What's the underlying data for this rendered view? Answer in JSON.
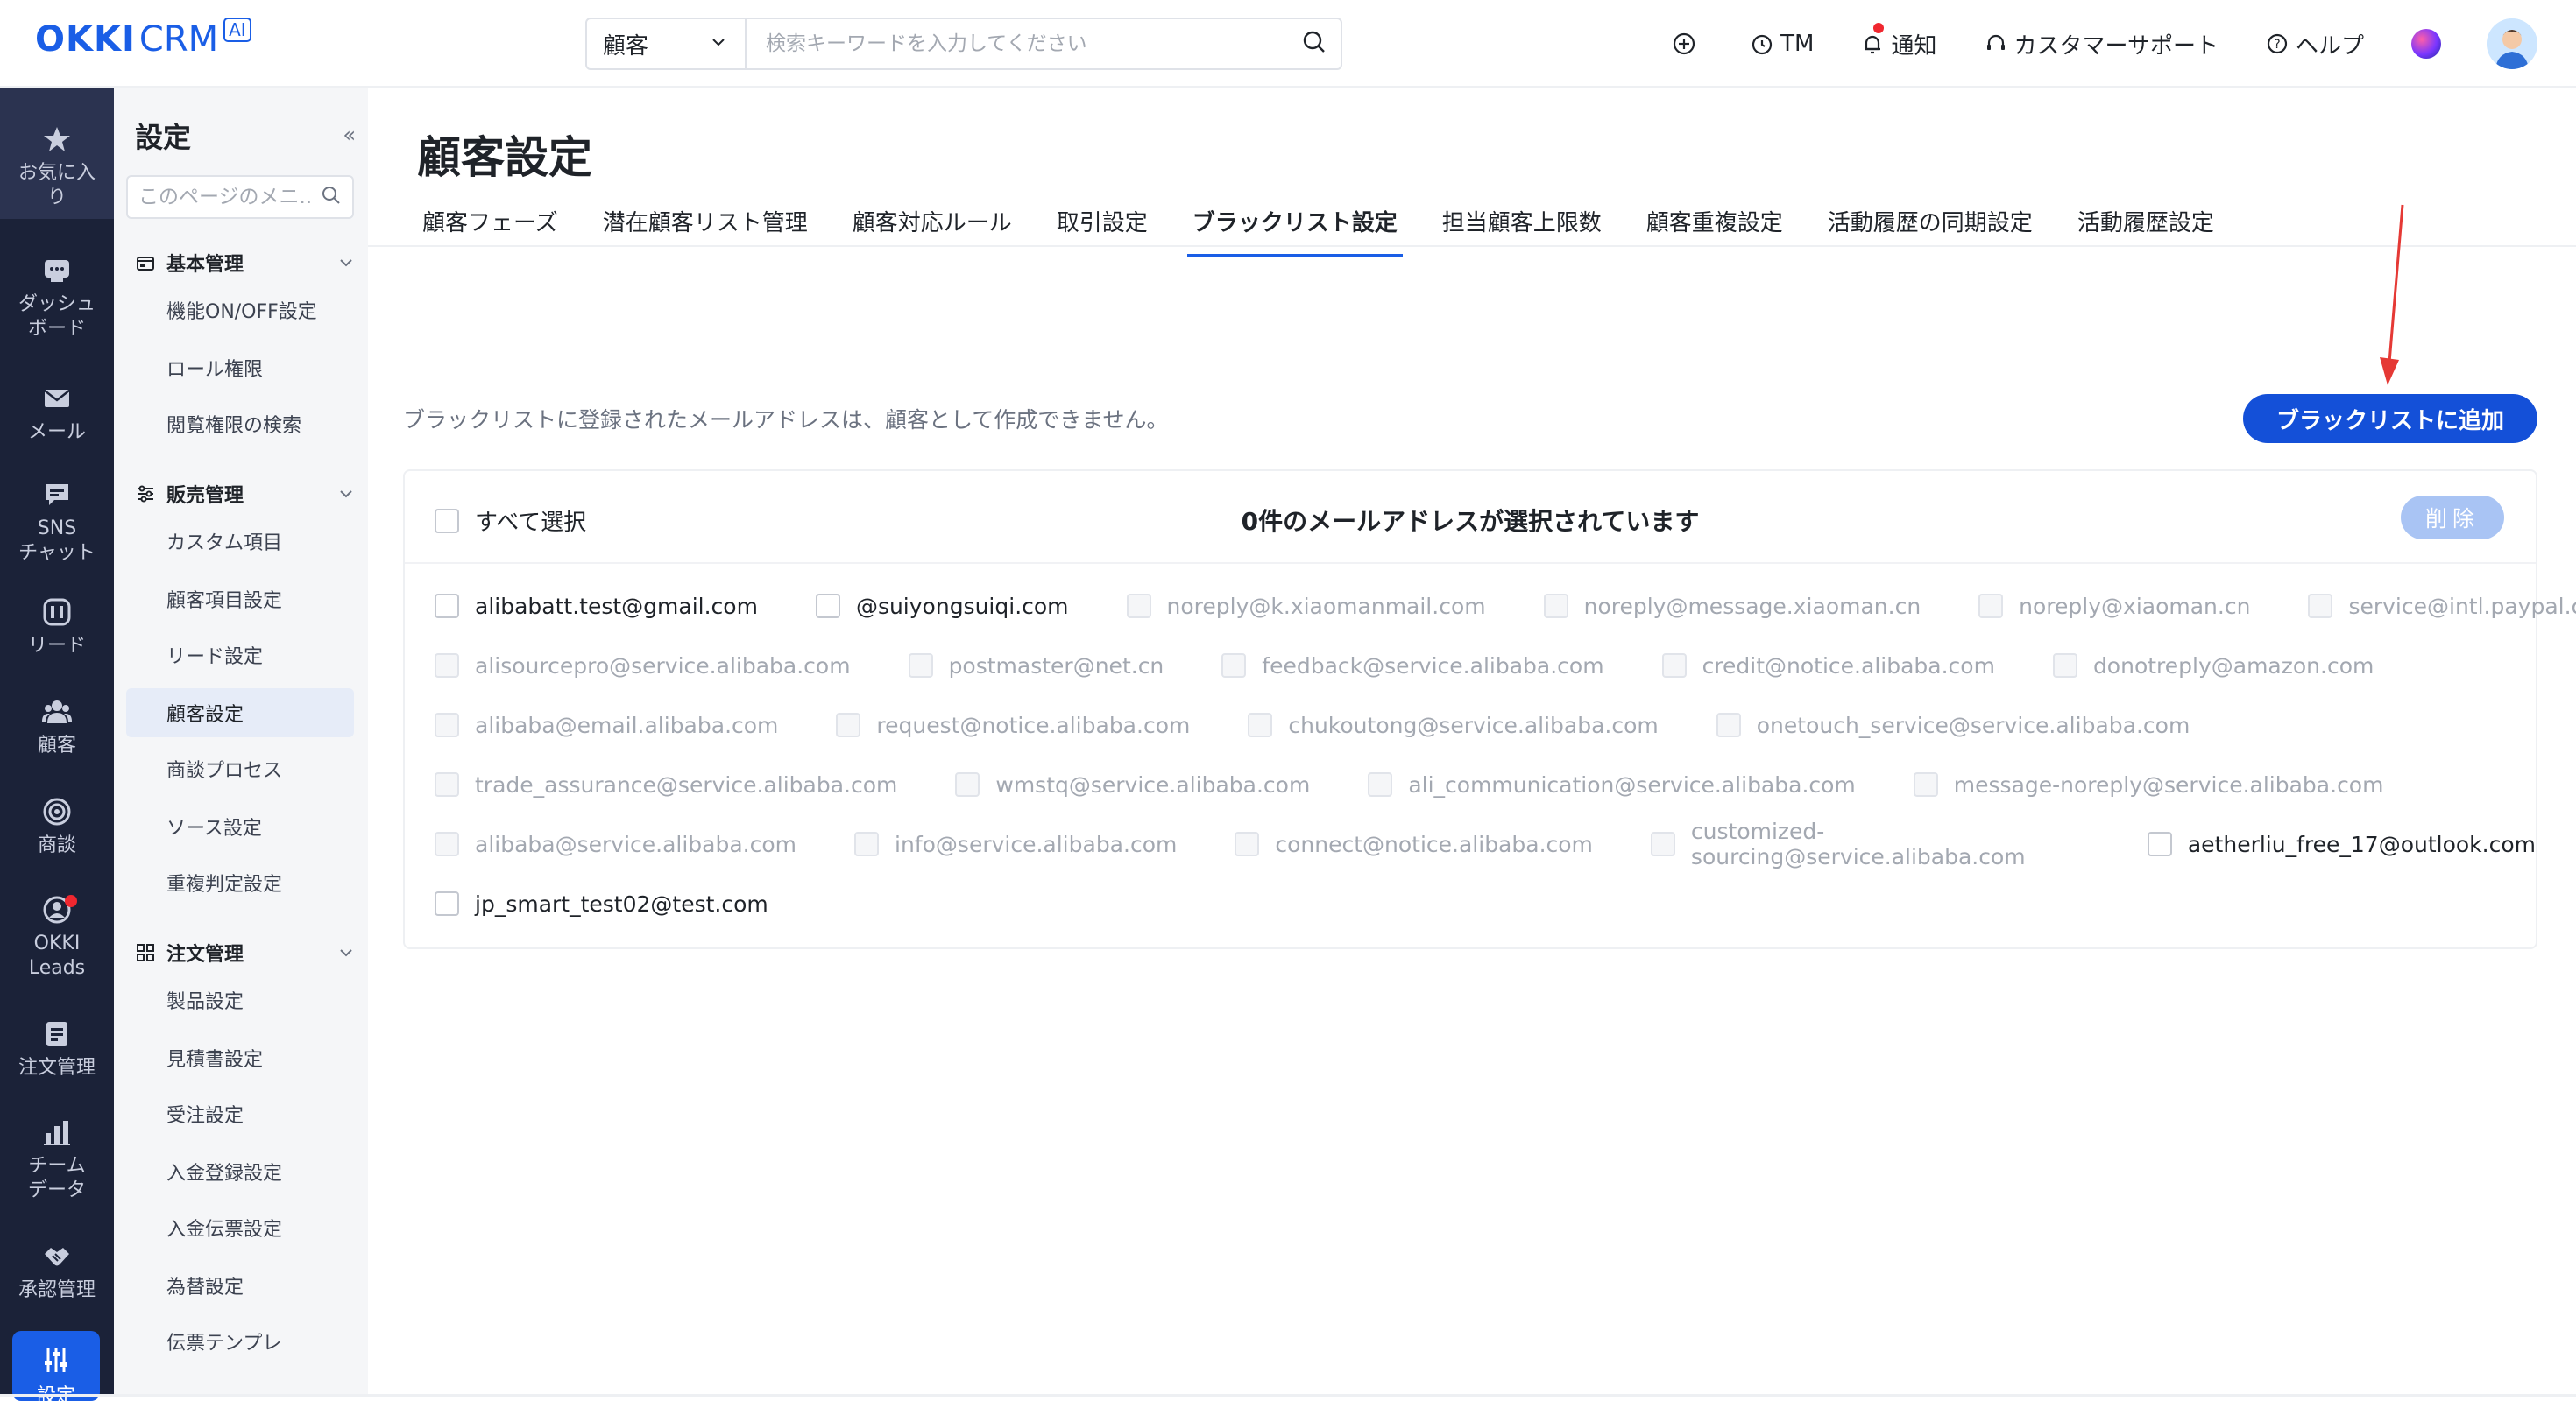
{
  "header": {
    "logo_main": "OKKI",
    "logo_sub": "CRM",
    "logo_badge": "AI",
    "search_scope": "顧客",
    "search_placeholder": "検索キーワードを入力してください",
    "right_items": [
      {
        "icon": "plus-circle-icon",
        "label": ""
      },
      {
        "icon": "clock-icon",
        "label": "TM"
      },
      {
        "icon": "bell-icon",
        "label": "通知"
      },
      {
        "icon": "headset-icon",
        "label": "カスタマーサポート"
      },
      {
        "icon": "help-circle-icon",
        "label": "ヘルプ"
      }
    ],
    "accent_color": "#1a5ee6"
  },
  "rail": {
    "items": [
      {
        "icon": "star-icon",
        "label1": "お気に入",
        "label2": "り"
      },
      {
        "icon": "dashboard-icon",
        "label1": "ダッシュ",
        "label2": "ボード"
      },
      {
        "icon": "mail-icon",
        "label1": "メール",
        "label2": ""
      },
      {
        "icon": "chat-icon",
        "label1": "SNS",
        "label2": "チャット"
      },
      {
        "icon": "lead-icon",
        "label1": "リード",
        "label2": ""
      },
      {
        "icon": "customers-icon",
        "label1": "顧客",
        "label2": ""
      },
      {
        "icon": "target-icon",
        "label1": "商談",
        "label2": ""
      },
      {
        "icon": "okki-leads-icon",
        "label1": "OKKI",
        "label2": "Leads"
      },
      {
        "icon": "order-icon",
        "label1": "注文管理",
        "label2": ""
      },
      {
        "icon": "bar-chart-icon",
        "label1": "チーム",
        "label2": "データ"
      },
      {
        "icon": "handshake-icon",
        "label1": "承認管理",
        "label2": ""
      }
    ],
    "active_label": "設定"
  },
  "submenu": {
    "title": "設定",
    "search_placeholder": "このページのメニ..",
    "groups": [
      {
        "label": "基本管理",
        "items": [
          "機能ON/OFF設定",
          "ロール権限",
          "閲覧権限の検索"
        ]
      },
      {
        "label": "販売管理",
        "items": [
          "カスタム項目",
          "顧客項目設定",
          "リード設定",
          "顧客設定",
          "商談プロセス",
          "ソース設定",
          "重複判定設定"
        ]
      },
      {
        "label": "注文管理",
        "items": [
          "製品設定",
          "見積書設定",
          "受注設定",
          "入金登録設定",
          "入金伝票設定",
          "為替設定",
          "伝票テンプレ"
        ]
      }
    ],
    "active_item": "顧客設定"
  },
  "main": {
    "title": "顧客設定",
    "tabs": [
      "顧客フェーズ",
      "潜在顧客リスト管理",
      "顧客対応ルール",
      "取引設定",
      "ブラックリスト設定",
      "担当顧客上限数",
      "顧客重複設定",
      "活動履歴の同期設定",
      "活動履歴設定"
    ],
    "active_tab": "ブラックリスト設定",
    "notice": "ブラックリストに登録されたメールアドレスは、顧客として作成できません。",
    "add_button": "ブラックリストに追加",
    "select_all": "すべて選択",
    "selected_count_text": "0件のメールアドレスが選択されています",
    "delete_button": "削除",
    "email_rows": [
      [
        {
          "email": "alibabatt.test@gmail.com",
          "disabled": false
        },
        {
          "email": "@suiyongsuiqi.com",
          "disabled": false
        },
        {
          "email": "noreply@k.xiaomanmail.com",
          "disabled": true
        },
        {
          "email": "noreply@message.xiaoman.cn",
          "disabled": true
        },
        {
          "email": "noreply@xiaoman.cn",
          "disabled": true
        },
        {
          "email": "service@intl.paypal.com",
          "disabled": true
        }
      ],
      [
        {
          "email": "alisourcepro@service.alibaba.com",
          "disabled": true
        },
        {
          "email": "postmaster@net.cn",
          "disabled": true
        },
        {
          "email": "feedback@service.alibaba.com",
          "disabled": true
        },
        {
          "email": "credit@notice.alibaba.com",
          "disabled": true
        },
        {
          "email": "donotreply@amazon.com",
          "disabled": true
        }
      ],
      [
        {
          "email": "alibaba@email.alibaba.com",
          "disabled": true
        },
        {
          "email": "request@notice.alibaba.com",
          "disabled": true
        },
        {
          "email": "chukoutong@service.alibaba.com",
          "disabled": true
        },
        {
          "email": "onetouch_service@service.alibaba.com",
          "disabled": true
        }
      ],
      [
        {
          "email": "trade_assurance@service.alibaba.com",
          "disabled": true
        },
        {
          "email": "wmstq@service.alibaba.com",
          "disabled": true
        },
        {
          "email": "ali_communication@service.alibaba.com",
          "disabled": true
        },
        {
          "email": "message-noreply@service.alibaba.com",
          "disabled": true
        }
      ],
      [
        {
          "email": "alibaba@service.alibaba.com",
          "disabled": true
        },
        {
          "email": "info@service.alibaba.com",
          "disabled": true
        },
        {
          "email": "connect@notice.alibaba.com",
          "disabled": true
        },
        {
          "email": "customized-sourcing@service.alibaba.com",
          "disabled": true
        },
        {
          "email": "aetherliu_free_17@outlook.com",
          "disabled": false
        }
      ],
      [
        {
          "email": "jp_smart_test02@test.com",
          "disabled": false
        }
      ]
    ]
  }
}
